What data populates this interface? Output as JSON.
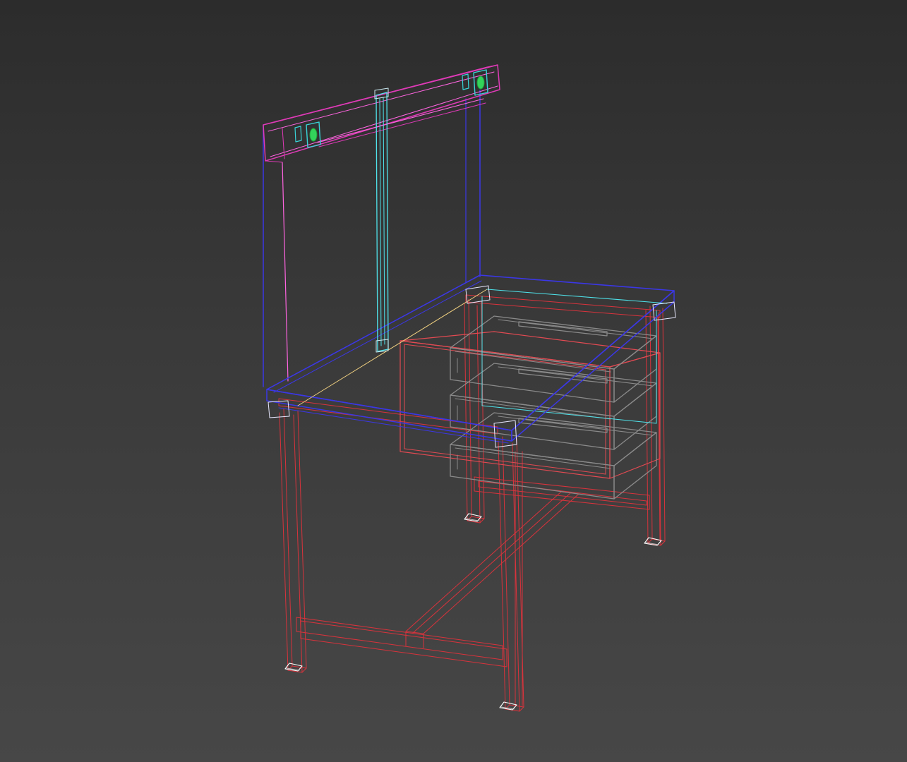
{
  "scene": {
    "background_top": "#2c2c2c",
    "background_bottom": "#474747"
  },
  "palette": {
    "frame": "#d8333c",
    "top": "#3b37e6",
    "panel_outline": "#3b37e6",
    "panel_rail": "#e03ab8",
    "panel_rail_inner": "#ff64e0",
    "support_bar": "#4fe4ec",
    "drawers": "#8a8a8a",
    "drawer_box": "#e24a52",
    "feet": "#ffffff",
    "top_edge_accent": "#f0d080",
    "lamp_body": "#39d4d8",
    "lamp_light": "#33d35a"
  },
  "objects": [
    {
      "name": "workbench-frame",
      "type": "wireframe-mesh"
    },
    {
      "name": "workbench-top",
      "type": "wireframe-mesh"
    },
    {
      "name": "back-panel",
      "type": "wireframe-mesh"
    },
    {
      "name": "drawer-unit",
      "type": "wireframe-mesh",
      "drawers": 3
    },
    {
      "name": "lamp-left",
      "type": "wireframe-mesh"
    },
    {
      "name": "lamp-right",
      "type": "wireframe-mesh"
    },
    {
      "name": "support-bar",
      "type": "wireframe-mesh"
    }
  ]
}
